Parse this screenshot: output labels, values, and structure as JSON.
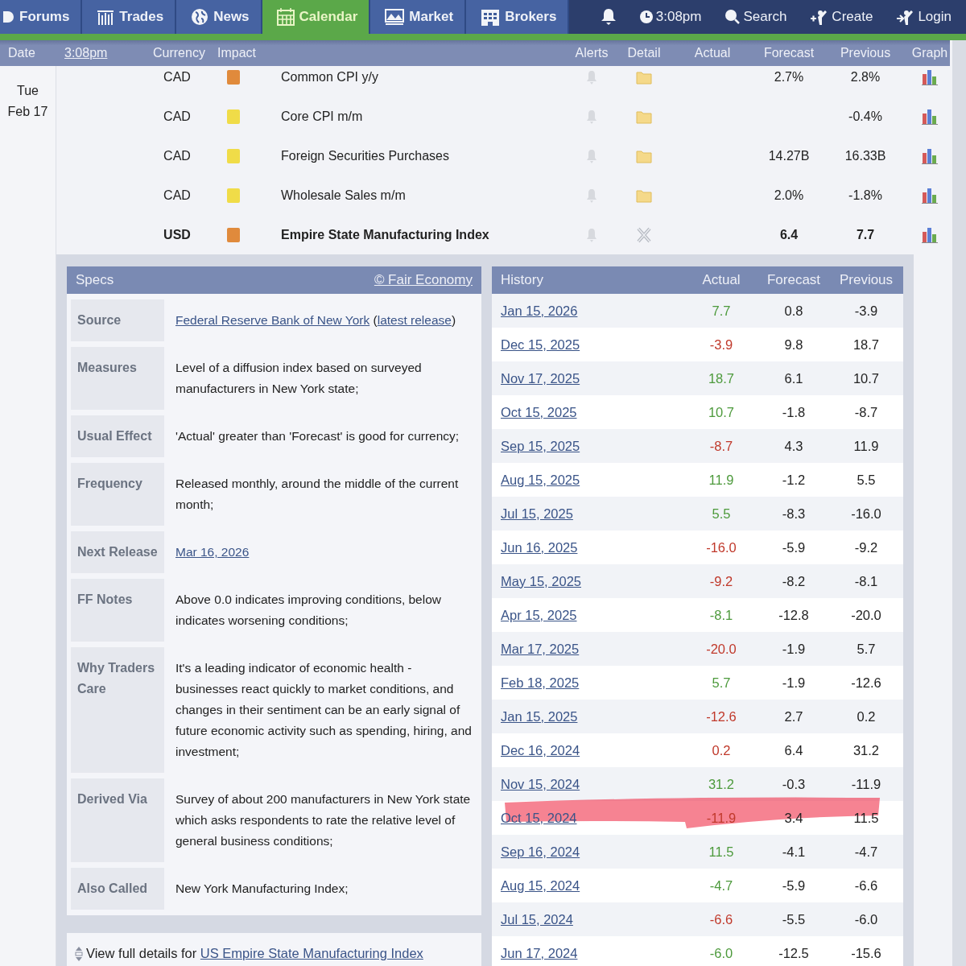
{
  "nav": {
    "tabs": [
      {
        "label": "Forums",
        "selected": false
      },
      {
        "label": "Trades",
        "selected": false
      },
      {
        "label": "News",
        "selected": false
      },
      {
        "label": "Calendar",
        "selected": true
      },
      {
        "label": "Market",
        "selected": false
      },
      {
        "label": "Brokers",
        "selected": false
      }
    ],
    "tools": [
      {
        "kind": "bell"
      },
      {
        "kind": "clock",
        "label": "3:08pm"
      },
      {
        "kind": "search",
        "label": "Search"
      },
      {
        "kind": "create",
        "label": "Create"
      },
      {
        "kind": "login",
        "label": "Login"
      }
    ]
  },
  "header": [
    {
      "label": "Date",
      "kind": "text"
    },
    {
      "label": "3:08pm",
      "kind": "link"
    },
    {
      "label": "Currency",
      "kind": "text"
    },
    {
      "label": "Impact",
      "kind": "text"
    },
    {
      "label": "Alerts",
      "kind": "text"
    },
    {
      "label": "Detail",
      "kind": "text"
    },
    {
      "label": "Actual",
      "kind": "text"
    },
    {
      "label": "Forecast",
      "kind": "text"
    },
    {
      "label": "Previous",
      "kind": "text"
    },
    {
      "label": "Graph",
      "kind": "text"
    }
  ],
  "day": {
    "weekday": "Tue",
    "date": "Feb 17"
  },
  "events": [
    {
      "currency": "CAD",
      "color": "#e08a3c",
      "name": "Common CPI y/y",
      "forecast": "2.7%",
      "previous": "2.8%",
      "expanded": false
    },
    {
      "currency": "CAD",
      "color": "#f0dc48",
      "name": "Core CPI m/m",
      "previous": "-0.4%",
      "expanded": false
    },
    {
      "currency": "CAD",
      "color": "#f0dc48",
      "name": "Foreign Securities Purchases",
      "forecast": "14.27B",
      "previous": "16.33B",
      "expanded": false
    },
    {
      "currency": "CAD",
      "color": "#f0dc48",
      "name": "Wholesale Sales m/m",
      "forecast": "2.0%",
      "previous": "-1.8%",
      "expanded": false
    },
    {
      "currency": "USD",
      "color": "#e08a3c",
      "name": "Empire State Manufacturing Index",
      "forecast": "6.4",
      "previous": "7.7",
      "expanded": true
    }
  ],
  "specs": {
    "title": "Specs",
    "credit": "© Fair Economy",
    "rows": [
      {
        "label": "Source",
        "parts": [
          {
            "kind": "link",
            "text": "Federal Reserve Bank of New York"
          },
          {
            "kind": "text",
            "text": " ("
          },
          {
            "kind": "link",
            "text": "latest release"
          },
          {
            "kind": "text",
            "text": ")"
          }
        ]
      },
      {
        "label": "Measures",
        "parts": [
          {
            "kind": "text",
            "text": "Level of a diffusion index based on surveyed manufacturers in New York state;"
          }
        ]
      },
      {
        "label": "Usual Effect",
        "parts": [
          {
            "kind": "text",
            "text": "'Actual' greater than 'Forecast' is good for currency;"
          }
        ]
      },
      {
        "label": "Frequency",
        "parts": [
          {
            "kind": "text",
            "text": "Released monthly, around the middle of the current month;"
          }
        ]
      },
      {
        "label": "Next Release",
        "parts": [
          {
            "kind": "link",
            "text": "Mar 16, 2026"
          }
        ]
      },
      {
        "label": "FF Notes",
        "parts": [
          {
            "kind": "text",
            "text": "Above 0.0 indicates improving conditions, below indicates worsening conditions;"
          }
        ]
      },
      {
        "label": "Why Traders Care",
        "parts": [
          {
            "kind": "text",
            "text": "It's a leading indicator of economic health - businesses react quickly to market conditions, and changes in their sentiment can be an early signal of future economic activity such as spending, hiring, and investment;"
          }
        ]
      },
      {
        "label": "Derived Via",
        "parts": [
          {
            "kind": "text",
            "text": "Survey of about 200 manufacturers in New York state which asks respondents to rate the relative level of general business conditions;"
          }
        ]
      },
      {
        "label": "Also Called",
        "parts": [
          {
            "kind": "text",
            "text": "New York Manufacturing Index;"
          }
        ]
      }
    ]
  },
  "full_details": {
    "text": "View full details for",
    "link": "US Empire State Manufacturing Index"
  },
  "history": {
    "title": "History",
    "columns": [
      "Actual",
      "Forecast",
      "Previous"
    ],
    "rows": [
      {
        "date": "Jan 15, 2026",
        "actual": "7.7",
        "forecast": "0.8",
        "previous": "-3.9",
        "color": "#4d9a3c",
        "marked": false
      },
      {
        "date": "Dec 15, 2025",
        "actual": "-3.9",
        "forecast": "9.8",
        "previous": "18.7",
        "color": "#c0392b",
        "marked": false
      },
      {
        "date": "Nov 17, 2025",
        "actual": "18.7",
        "forecast": "6.1",
        "previous": "10.7",
        "color": "#4d9a3c",
        "marked": false
      },
      {
        "date": "Oct 15, 2025",
        "actual": "10.7",
        "forecast": "-1.8",
        "previous": "-8.7",
        "color": "#4d9a3c",
        "marked": false
      },
      {
        "date": "Sep 15, 2025",
        "actual": "-8.7",
        "forecast": "4.3",
        "previous": "11.9",
        "color": "#c0392b",
        "marked": false
      },
      {
        "date": "Aug 15, 2025",
        "actual": "11.9",
        "forecast": "-1.2",
        "previous": "5.5",
        "color": "#4d9a3c",
        "marked": false
      },
      {
        "date": "Jul 15, 2025",
        "actual": "5.5",
        "forecast": "-8.3",
        "previous": "-16.0",
        "color": "#4d9a3c",
        "marked": false
      },
      {
        "date": "Jun 16, 2025",
        "actual": "-16.0",
        "forecast": "-5.9",
        "previous": "-9.2",
        "color": "#c0392b",
        "marked": false
      },
      {
        "date": "May 15, 2025",
        "actual": "-9.2",
        "forecast": "-8.2",
        "previous": "-8.1",
        "color": "#c0392b",
        "marked": false
      },
      {
        "date": "Apr 15, 2025",
        "actual": "-8.1",
        "forecast": "-12.8",
        "previous": "-20.0",
        "color": "#4d9a3c",
        "marked": false
      },
      {
        "date": "Mar 17, 2025",
        "actual": "-20.0",
        "forecast": "-1.9",
        "previous": "5.7",
        "color": "#c0392b",
        "marked": false
      },
      {
        "date": "Feb 18, 2025",
        "actual": "5.7",
        "forecast": "-1.9",
        "previous": "-12.6",
        "color": "#4d9a3c",
        "marked": false
      },
      {
        "date": "Jan 15, 2025",
        "actual": "-12.6",
        "forecast": "2.7",
        "previous": "0.2",
        "color": "#c0392b",
        "marked": false
      },
      {
        "date": "Dec 16, 2024",
        "actual": "0.2",
        "forecast": "6.4",
        "previous": "31.2",
        "color": "#c0392b",
        "marked": false
      },
      {
        "date": "Nov 15, 2024",
        "actual": "31.2",
        "forecast": "-0.3",
        "previous": "-11.9",
        "color": "#4d9a3c",
        "marked": false
      },
      {
        "date": "Oct 15, 2024",
        "actual": "-11.9",
        "forecast": "3.4",
        "previous": "11.5",
        "color": "#c0392b",
        "marked": true
      },
      {
        "date": "Sep 16, 2024",
        "actual": "11.5",
        "forecast": "-4.1",
        "previous": "-4.7",
        "color": "#4d9a3c",
        "marked": false
      },
      {
        "date": "Aug 15, 2024",
        "actual": "-4.7",
        "forecast": "-5.9",
        "previous": "-6.6",
        "color": "#4d9a3c",
        "marked": false
      },
      {
        "date": "Jul 15, 2024",
        "actual": "-6.6",
        "forecast": "-5.5",
        "previous": "-6.0",
        "color": "#c0392b",
        "marked": false
      },
      {
        "date": "Jun 17, 2024",
        "actual": "-6.0",
        "forecast": "-12.5",
        "previous": "-15.6",
        "color": "#4d9a3c",
        "marked": false
      }
    ]
  }
}
